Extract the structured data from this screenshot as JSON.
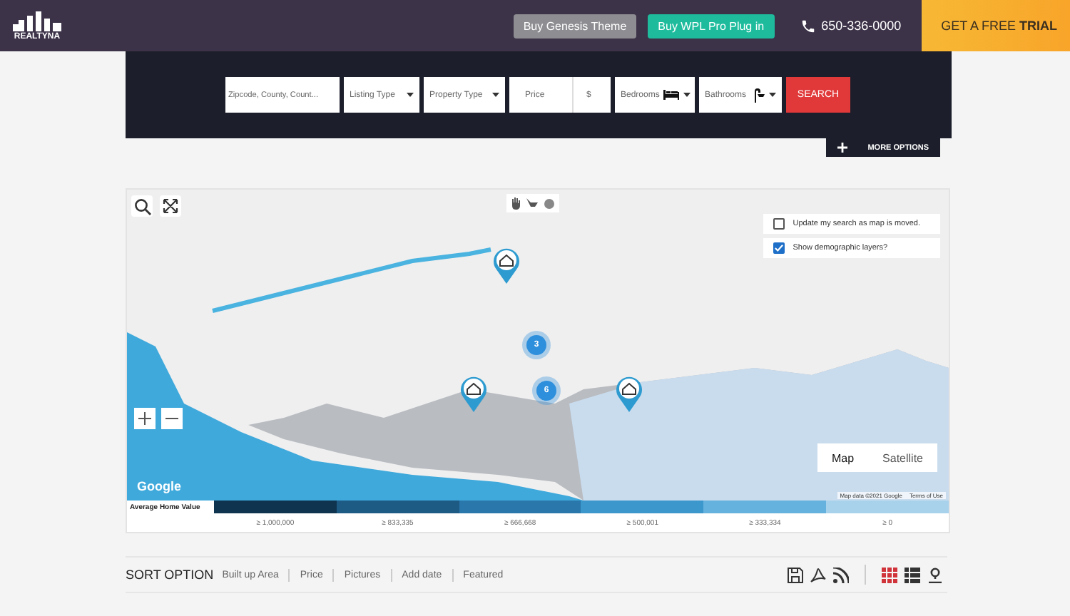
{
  "header": {
    "logo": "REALTYNA",
    "buttons": [
      {
        "label": "Buy Genesis Theme",
        "kind": "grey"
      },
      {
        "label": "Buy WPL Pro Plug in",
        "kind": "green"
      }
    ],
    "phone": "650-336-0000",
    "trial": {
      "text": "GET A FREE ",
      "bold": "TRIAL"
    }
  },
  "search": {
    "fields": [
      {
        "kind": "text",
        "placeholder": "Zipcode, County, Count..."
      },
      {
        "kind": "select",
        "label": "Listing Type"
      },
      {
        "kind": "select",
        "label": "Property Type"
      },
      {
        "kind": "price",
        "label": "Price",
        "unit": "$"
      },
      {
        "kind": "bed",
        "label": "Bedrooms"
      },
      {
        "kind": "bath",
        "label": "Bathrooms"
      }
    ],
    "button": "SEARCH",
    "more": "MORE OPTIONS"
  },
  "map": {
    "options": [
      {
        "label": "Update my search as map is moved.",
        "checked": false
      },
      {
        "label": "Show demographic layers?",
        "checked": true
      }
    ],
    "markers": [
      {
        "kind": "pin"
      },
      {
        "kind": "cluster",
        "count": "3"
      },
      {
        "kind": "pin"
      },
      {
        "kind": "cluster",
        "count": "6"
      },
      {
        "kind": "pin"
      }
    ],
    "map_types": [
      {
        "label": "Map",
        "selected": true
      },
      {
        "label": "Satellite",
        "selected": false
      }
    ],
    "attribution": "Map data ©2021 Google",
    "terms": "Terms of Use",
    "brand": "Google",
    "legend": {
      "title": "Average Home Value",
      "bins": [
        {
          "color": "#0f3450",
          "label": "≥ 1,000,000"
        },
        {
          "color": "#1d5b85",
          "label": "≥ 833,335"
        },
        {
          "color": "#2a77ab",
          "label": "≥ 666,668"
        },
        {
          "color": "#3c97cc",
          "label": "≥ 500,001"
        },
        {
          "color": "#66b2de",
          "label": "≥ 333,334"
        },
        {
          "color": "#a8d1ec",
          "label": "≥ 0"
        }
      ]
    }
  },
  "sort": {
    "title": "SORT OPTION",
    "options": [
      "Built up Area",
      "Price",
      "Pictures",
      "Add date",
      "Featured"
    ],
    "views": [
      {
        "kind": "grid",
        "selected": true
      },
      {
        "kind": "list",
        "selected": false
      },
      {
        "kind": "map",
        "selected": false
      }
    ]
  }
}
